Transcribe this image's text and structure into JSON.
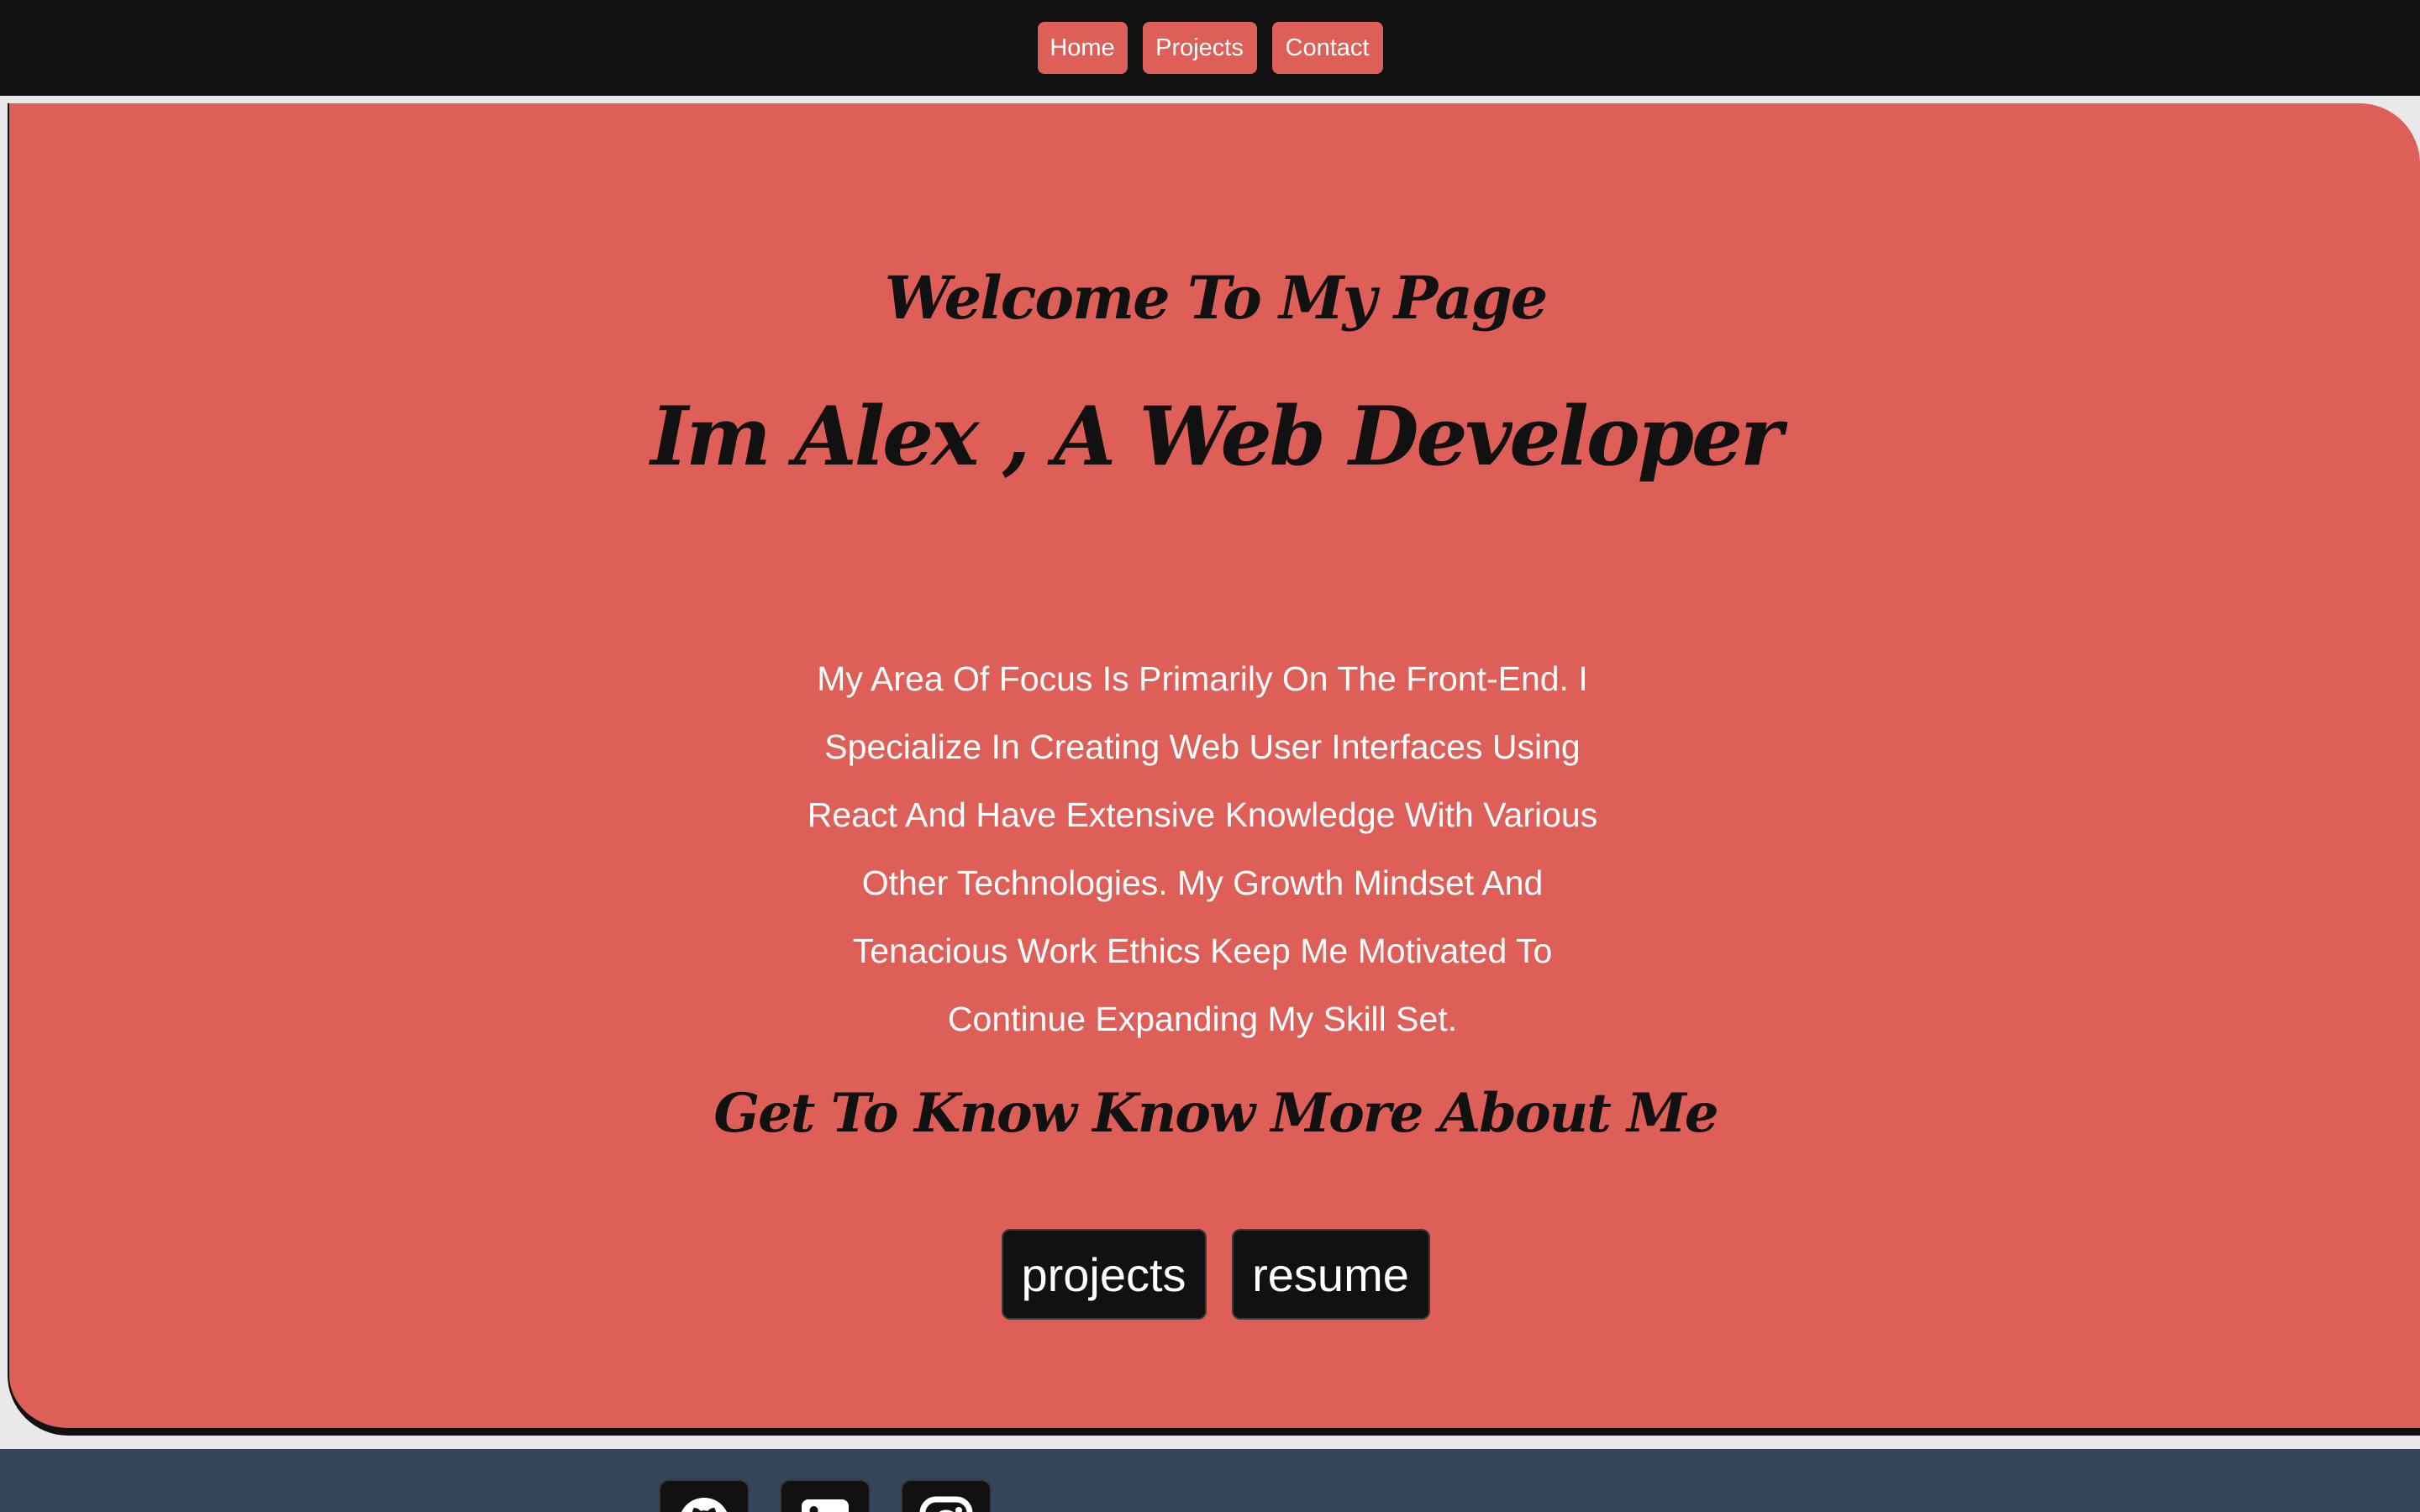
{
  "nav": {
    "items": [
      {
        "label": "Home"
      },
      {
        "label": "Projects"
      },
      {
        "label": "Contact"
      }
    ]
  },
  "hero": {
    "welcome": "Welcome To My Page",
    "headline": "Im Alex , A Web Developer",
    "bio": "My Area Of Focus Is Primarily On The Front-End. I Specialize In Creating Web User Interfaces Using React And Have Extensive Knowledge With Various Other Technologies. My Growth Mindset And Tenacious Work Ethics Keep Me Motivated To Continue Expanding My Skill Set.",
    "know_more": "Get To Know Know More About Me",
    "buttons": {
      "projects": "projects",
      "resume": "resume"
    }
  },
  "footer": {
    "social_icons": [
      "github-icon",
      "linkedin-icon",
      "instagram-icon"
    ]
  },
  "colors": {
    "accent": "#de5e58",
    "nav_background": "#111111",
    "footer_background": "#34455b",
    "text_dark": "#111111",
    "text_light": "#ffffff"
  }
}
